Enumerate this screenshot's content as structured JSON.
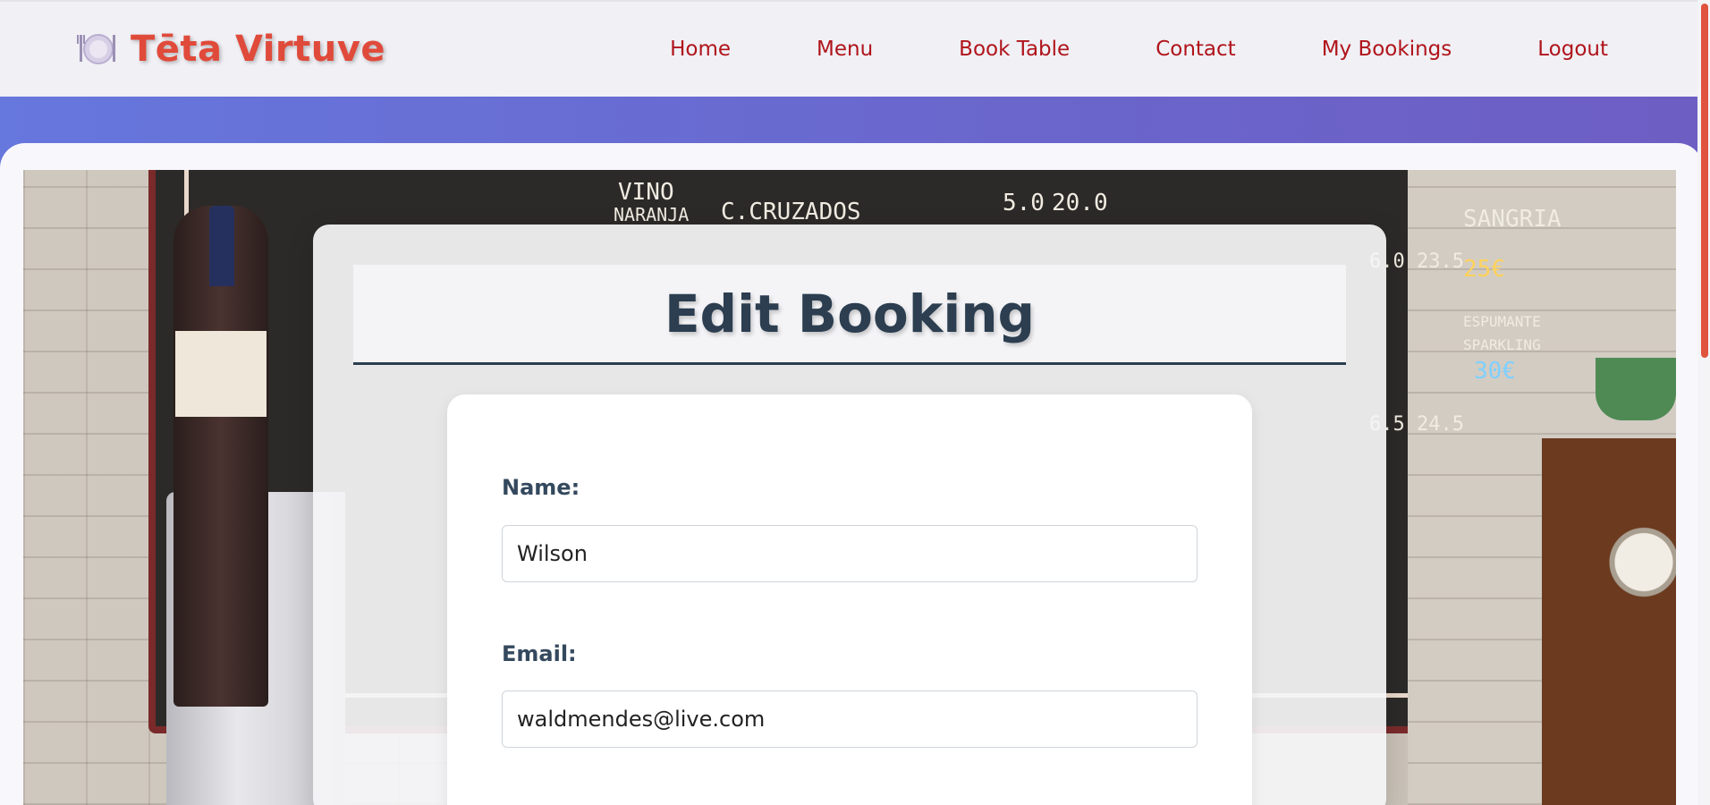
{
  "brand": {
    "icon": "plate-cutlery-icon",
    "title": "Tēta Virtuve"
  },
  "nav": {
    "items": [
      {
        "label": "Home"
      },
      {
        "label": "Menu"
      },
      {
        "label": "Book Table"
      },
      {
        "label": "Contact"
      },
      {
        "label": "My Bookings"
      },
      {
        "label": "Logout"
      }
    ]
  },
  "page": {
    "title": "Edit Booking"
  },
  "form": {
    "name_label": "Name:",
    "name_value": "Wilson",
    "email_label": "Email:",
    "email_value": "waldmendes@live.com"
  },
  "background": {
    "chalk_lines": [
      "VINO",
      "NARANJA",
      "C.CRUZADOS",
      "5.0",
      "20.0",
      "SANGRIA",
      "6.0 23.5",
      "25€",
      "30€",
      "6.5 24.5",
      "ESPUMANTE",
      "SPARKLING"
    ]
  },
  "colors": {
    "brand": "#e04a3a",
    "nav_link": "#b0141b",
    "heading": "#2c3e50",
    "band": "#6677dd"
  }
}
